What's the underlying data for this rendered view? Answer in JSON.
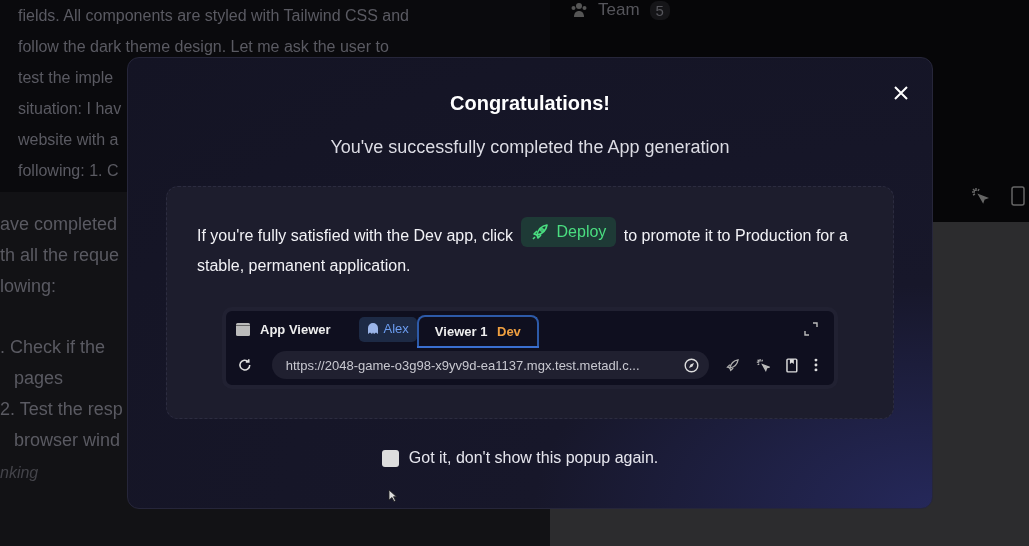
{
  "chat": {
    "upper_lines": [
      "fields. All components are styled with Tailwind CSS and",
      "follow the dark theme design. Let me ask the user to",
      "test the imple",
      "situation: I hav",
      "website with a",
      "following: 1. C"
    ],
    "lower_lines": [
      "ave completed",
      "th all the reque",
      "lowing:"
    ],
    "list_items": [
      {
        "marker": ". Check if the",
        "text": "pages"
      },
      {
        "marker": "2. Test the resp",
        "text": "browser wind"
      }
    ],
    "status": "nking"
  },
  "team": {
    "label": "Team",
    "count": "5"
  },
  "modal": {
    "title": "Congratulations!",
    "subtitle": "You've successfully completed the App generation",
    "message_before": "If you're fully satisfied with the Dev app, click",
    "deploy_label": "Deploy",
    "message_after": "to promote it to Production for a stable, permanent application.",
    "viewer": {
      "title": "App Viewer",
      "tabs": [
        {
          "label": "Alex",
          "kind": "user",
          "selected": false
        },
        {
          "label": "Viewer 1",
          "badge": "Dev",
          "kind": "viewer",
          "selected": true
        }
      ],
      "url": "https://2048-game-o3g98-x9yv9d-ea1137.mgx.test.metadl.c..."
    },
    "dont_show": {
      "label": "Got it, don't show this popup again.",
      "checked": false
    }
  }
}
